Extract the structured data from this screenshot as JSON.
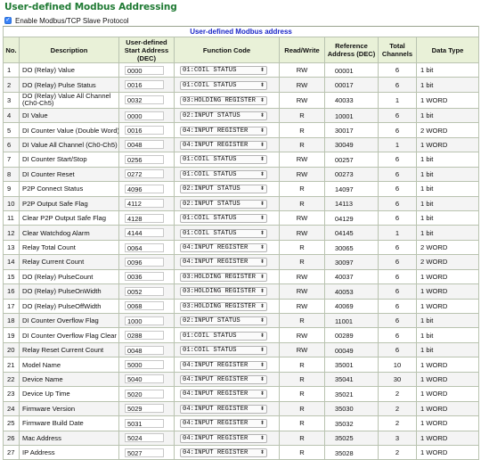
{
  "page": {
    "title": "User-defined Modbus Addressing",
    "enable_label": "Enable Modbus/TCP Slave Protocol",
    "enable_checked": true,
    "table_caption": "User-defined Modbus address"
  },
  "columns": [
    "No.",
    "Description",
    "User-defined Start Address (DEC)",
    "Function Code",
    "Read/Write",
    "Reference Address (DEC)",
    "Total Channels",
    "Data Type"
  ],
  "rows": [
    {
      "no": "1",
      "desc": "DO (Relay) Value",
      "start": "0000",
      "func": "01:COIL STATUS",
      "rw": "RW",
      "ref": "00001",
      "ch": "6",
      "dtype": "1 bit"
    },
    {
      "no": "2",
      "desc": "DO (Relay) Pulse Status",
      "start": "0016",
      "func": "01:COIL STATUS",
      "rw": "RW",
      "ref": "00017",
      "ch": "6",
      "dtype": "1 bit"
    },
    {
      "no": "3",
      "desc": "DO (Relay) Value All Channel (Ch0-Ch5)",
      "start": "0032",
      "func": "03:HOLDING REGISTER",
      "rw": "RW",
      "ref": "40033",
      "ch": "1",
      "dtype": "1 WORD"
    },
    {
      "no": "4",
      "desc": "DI Value",
      "start": "0000",
      "func": "02:INPUT STATUS",
      "rw": "R",
      "ref": "10001",
      "ch": "6",
      "dtype": "1 bit"
    },
    {
      "no": "5",
      "desc": "DI Counter Value (Double Word)",
      "start": "0016",
      "func": "04:INPUT REGISTER",
      "rw": "R",
      "ref": "30017",
      "ch": "6",
      "dtype": "2 WORD"
    },
    {
      "no": "6",
      "desc": "DI Value All Channel (Ch0-Ch5)",
      "start": "0048",
      "func": "04:INPUT REGISTER",
      "rw": "R",
      "ref": "30049",
      "ch": "1",
      "dtype": "1 WORD"
    },
    {
      "no": "7",
      "desc": "DI Counter Start/Stop",
      "start": "0256",
      "func": "01:COIL STATUS",
      "rw": "RW",
      "ref": "00257",
      "ch": "6",
      "dtype": "1 bit"
    },
    {
      "no": "8",
      "desc": "DI Counter Reset",
      "start": "0272",
      "func": "01:COIL STATUS",
      "rw": "RW",
      "ref": "00273",
      "ch": "6",
      "dtype": "1 bit"
    },
    {
      "no": "9",
      "desc": "P2P Connect Status",
      "start": "4096",
      "func": "02:INPUT STATUS",
      "rw": "R",
      "ref": "14097",
      "ch": "6",
      "dtype": "1 bit"
    },
    {
      "no": "10",
      "desc": "P2P Output Safe Flag",
      "start": "4112",
      "func": "02:INPUT STATUS",
      "rw": "R",
      "ref": "14113",
      "ch": "6",
      "dtype": "1 bit"
    },
    {
      "no": "11",
      "desc": "Clear P2P Output Safe Flag",
      "start": "4128",
      "func": "01:COIL STATUS",
      "rw": "RW",
      "ref": "04129",
      "ch": "6",
      "dtype": "1 bit"
    },
    {
      "no": "12",
      "desc": "Clear Watchdog Alarm",
      "start": "4144",
      "func": "01:COIL STATUS",
      "rw": "RW",
      "ref": "04145",
      "ch": "1",
      "dtype": "1 bit"
    },
    {
      "no": "13",
      "desc": "Relay Total Count",
      "start": "0064",
      "func": "04:INPUT REGISTER",
      "rw": "R",
      "ref": "30065",
      "ch": "6",
      "dtype": "2 WORD"
    },
    {
      "no": "14",
      "desc": "Relay Current Count",
      "start": "0096",
      "func": "04:INPUT REGISTER",
      "rw": "R",
      "ref": "30097",
      "ch": "6",
      "dtype": "2 WORD"
    },
    {
      "no": "15",
      "desc": "DO (Relay) PulseCount",
      "start": "0036",
      "func": "03:HOLDING REGISTER",
      "rw": "RW",
      "ref": "40037",
      "ch": "6",
      "dtype": "1 WORD"
    },
    {
      "no": "16",
      "desc": "DO (Relay) PulseOnWidth",
      "start": "0052",
      "func": "03:HOLDING REGISTER",
      "rw": "RW",
      "ref": "40053",
      "ch": "6",
      "dtype": "1 WORD"
    },
    {
      "no": "17",
      "desc": "DO (Relay) PulseOffWidth",
      "start": "0068",
      "func": "03:HOLDING REGISTER",
      "rw": "RW",
      "ref": "40069",
      "ch": "6",
      "dtype": "1 WORD"
    },
    {
      "no": "18",
      "desc": "DI Counter Overflow Flag",
      "start": "1000",
      "func": "02:INPUT STATUS",
      "rw": "R",
      "ref": "11001",
      "ch": "6",
      "dtype": "1 bit"
    },
    {
      "no": "19",
      "desc": "DI Counter Overflow Flag Clear",
      "start": "0288",
      "func": "01:COIL STATUS",
      "rw": "RW",
      "ref": "00289",
      "ch": "6",
      "dtype": "1 bit"
    },
    {
      "no": "20",
      "desc": "Relay Reset Current Count",
      "start": "0048",
      "func": "01:COIL STATUS",
      "rw": "RW",
      "ref": "00049",
      "ch": "6",
      "dtype": "1 bit"
    },
    {
      "no": "21",
      "desc": "Model Name",
      "start": "5000",
      "func": "04:INPUT REGISTER",
      "rw": "R",
      "ref": "35001",
      "ch": "10",
      "dtype": "1 WORD"
    },
    {
      "no": "22",
      "desc": "Device Name",
      "start": "5040",
      "func": "04:INPUT REGISTER",
      "rw": "R",
      "ref": "35041",
      "ch": "30",
      "dtype": "1 WORD"
    },
    {
      "no": "23",
      "desc": "Device Up Time",
      "start": "5020",
      "func": "04:INPUT REGISTER",
      "rw": "R",
      "ref": "35021",
      "ch": "2",
      "dtype": "1 WORD"
    },
    {
      "no": "24",
      "desc": "Firmware Version",
      "start": "5029",
      "func": "04:INPUT REGISTER",
      "rw": "R",
      "ref": "35030",
      "ch": "2",
      "dtype": "1 WORD"
    },
    {
      "no": "25",
      "desc": "Firmware Build Date",
      "start": "5031",
      "func": "04:INPUT REGISTER",
      "rw": "R",
      "ref": "35032",
      "ch": "2",
      "dtype": "1 WORD"
    },
    {
      "no": "26",
      "desc": "Mac Address",
      "start": "5024",
      "func": "04:INPUT REGISTER",
      "rw": "R",
      "ref": "35025",
      "ch": "3",
      "dtype": "1 WORD"
    },
    {
      "no": "27",
      "desc": "IP Address",
      "start": "5027",
      "func": "04:INPUT REGISTER",
      "rw": "R",
      "ref": "35028",
      "ch": "2",
      "dtype": "1 WORD"
    }
  ]
}
